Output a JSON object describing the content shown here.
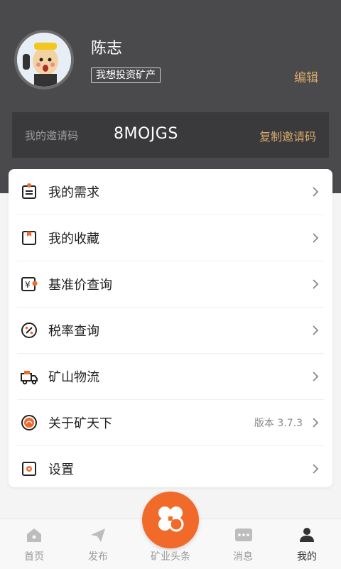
{
  "profile": {
    "name": "陈志",
    "tag": "我想投资矿产",
    "edit_label": "编辑"
  },
  "invite": {
    "label": "我的邀请码",
    "code": "8MOJGS",
    "copy_label": "复制邀请码"
  },
  "menu": [
    {
      "label": "我的需求",
      "icon": "clipboard-icon"
    },
    {
      "label": "我的收藏",
      "icon": "bookmark-icon"
    },
    {
      "label": "基准价查询",
      "icon": "yen-price-icon"
    },
    {
      "label": "税率查询",
      "icon": "percent-icon"
    },
    {
      "label": "矿山物流",
      "icon": "truck-icon"
    },
    {
      "label": "关于矿天下",
      "icon": "logo-icon",
      "extra": "版本 3.7.3"
    },
    {
      "label": "设置",
      "icon": "settings-icon"
    }
  ],
  "tabs": [
    {
      "label": "首页",
      "icon": "home-icon"
    },
    {
      "label": "发布",
      "icon": "send-icon"
    },
    {
      "label": "矿业头条",
      "icon": "clover-icon"
    },
    {
      "label": "消息",
      "icon": "message-icon"
    },
    {
      "label": "我的",
      "icon": "user-icon",
      "active": true
    }
  ],
  "colors": {
    "header_bg": "#4a4a4c",
    "accent_gold": "#d8a86a",
    "accent_orange": "#f26a2a"
  }
}
